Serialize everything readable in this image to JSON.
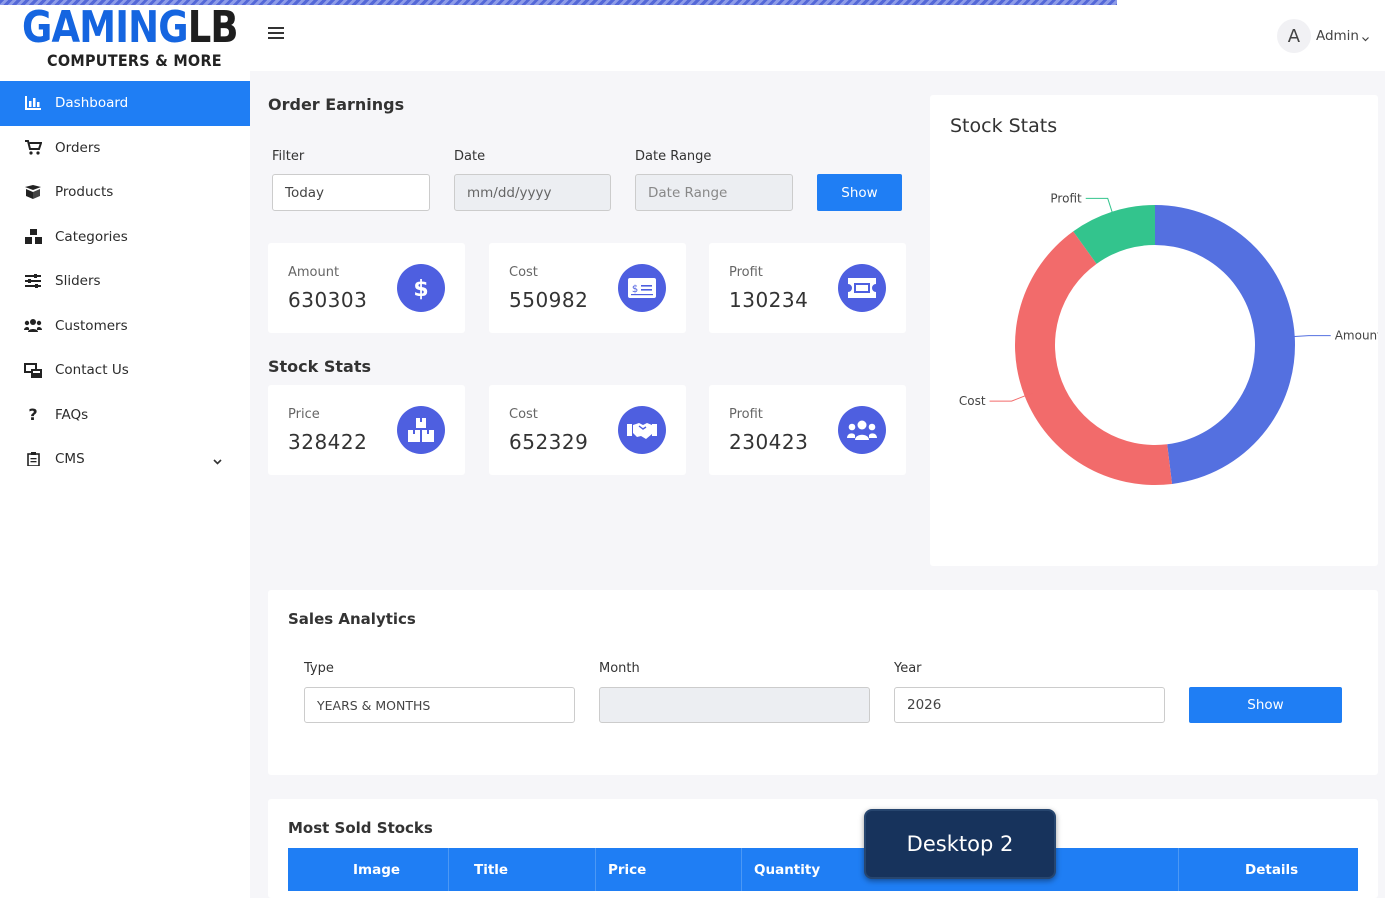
{
  "brand": {
    "logo_main": "GAMING",
    "logo_accent": "LB",
    "logo_sub": "COMPUTERS & MORE"
  },
  "sidebar": {
    "items": [
      {
        "label": "Dashboard",
        "icon": "chart-bar-icon"
      },
      {
        "label": "Orders",
        "icon": "cart-icon"
      },
      {
        "label": "Products",
        "icon": "box-icon"
      },
      {
        "label": "Categories",
        "icon": "boxes-icon"
      },
      {
        "label": "Sliders",
        "icon": "sliders-icon"
      },
      {
        "label": "Customers",
        "icon": "users-icon"
      },
      {
        "label": "Contact Us",
        "icon": "contact-icon"
      },
      {
        "label": "FAQs",
        "icon": "question-icon"
      },
      {
        "label": "CMS",
        "icon": "clipboard-icon"
      }
    ]
  },
  "header": {
    "avatar_letter": "A",
    "user_name": "Admin"
  },
  "order_earnings": {
    "title": "Order Earnings",
    "filter_label": "Filter",
    "filter_value": "Today",
    "date_label": "Date",
    "date_placeholder": "mm/dd/yyyy",
    "range_label": "Date Range",
    "range_placeholder": "Date Range",
    "show_label": "Show",
    "cards": [
      {
        "label": "Amount",
        "value": "630303"
      },
      {
        "label": "Cost",
        "value": "550982"
      },
      {
        "label": "Profit",
        "value": "130234"
      }
    ]
  },
  "stock_stats_cards": {
    "title": "Stock Stats",
    "cards": [
      {
        "label": "Price",
        "value": "328422"
      },
      {
        "label": "Cost",
        "value": "652329"
      },
      {
        "label": "Profit",
        "value": "230423"
      }
    ]
  },
  "stock_chart": {
    "title": "Stock Stats"
  },
  "chart_data": {
    "type": "pie",
    "categories": [
      "Amount",
      "Cost",
      "Profit"
    ],
    "values": [
      630303,
      550982,
      130234
    ],
    "colors": [
      "#5470e0",
      "#f26b6b",
      "#33c48d"
    ],
    "title": "Stock Stats"
  },
  "sales_analytics": {
    "title": "Sales Analytics",
    "type_label": "Type",
    "type_value": "YEARS & MONTHS",
    "month_label": "Month",
    "month_value": "",
    "year_label": "Year",
    "year_value": "2026",
    "show_label": "Show"
  },
  "most_sold": {
    "title": "Most Sold Stocks",
    "columns": [
      "Image",
      "Title",
      "Price",
      "Quantity",
      "Details"
    ]
  },
  "overlay": {
    "label": "Desktop 2"
  },
  "colors": {
    "primary": "#1f7ef4",
    "icon_bg": "#4e5fe0"
  }
}
